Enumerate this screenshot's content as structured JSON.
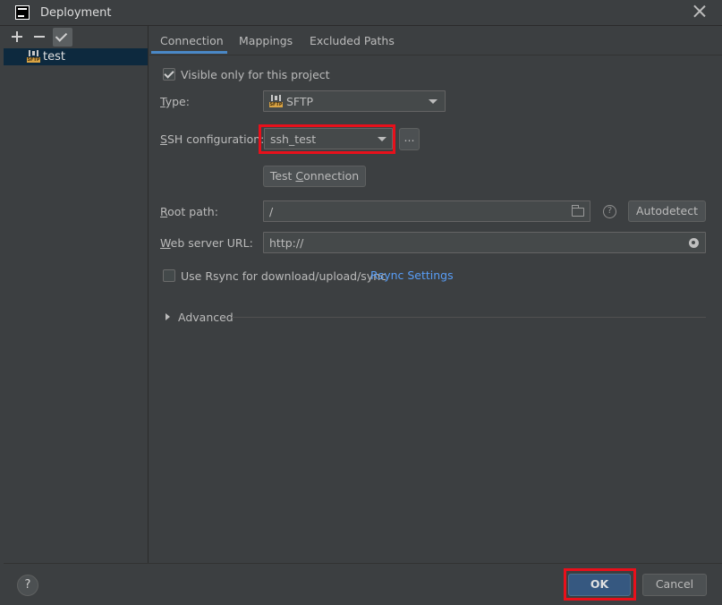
{
  "window": {
    "title": "Deployment"
  },
  "left_panel": {
    "servers": [
      {
        "name": "test",
        "icon": "sftp-server-icon",
        "icon_tag": "SFTP"
      }
    ]
  },
  "tabs": [
    {
      "label": "Connection",
      "active": true
    },
    {
      "label": "Mappings",
      "active": false
    },
    {
      "label": "Excluded Paths",
      "active": false
    }
  ],
  "connection": {
    "visible_only_label": "Visible only for this project",
    "visible_only_checked": true,
    "type_label_mnemonic": "T",
    "type_label_rest": "ype:",
    "type_value": "SFTP",
    "type_icon_tag": "SFTP",
    "ssh_label_mnemonic": "S",
    "ssh_label_rest": "SH configuration:",
    "ssh_value": "ssh_test",
    "ssh_more_button": "...",
    "test_connection_pre": "Test ",
    "test_connection_mnemonic": "C",
    "test_connection_post": "onnection",
    "root_path_label_mnemonic": "R",
    "root_path_label_rest": "oot path:",
    "root_path_value": "/",
    "help_icon_glyph": "?",
    "autodetect_button": "Autodetect",
    "web_url_label_mnemonic": "W",
    "web_url_label_rest": "eb server URL:",
    "web_url_value": "http://",
    "rsync_label": "Use Rsync for download/upload/sync",
    "rsync_checked": false,
    "rsync_settings_link": "Rsync Settings",
    "advanced_label": "Advanced"
  },
  "footer": {
    "help_glyph": "?",
    "ok_button": "OK",
    "cancel_button": "Cancel"
  },
  "colors": {
    "background": "#3c3f41",
    "selection": "#0d293e",
    "accent_tab": "#4a88c7",
    "link": "#589df6",
    "highlight_box": "#e8101b",
    "ok_button": "#365880"
  }
}
